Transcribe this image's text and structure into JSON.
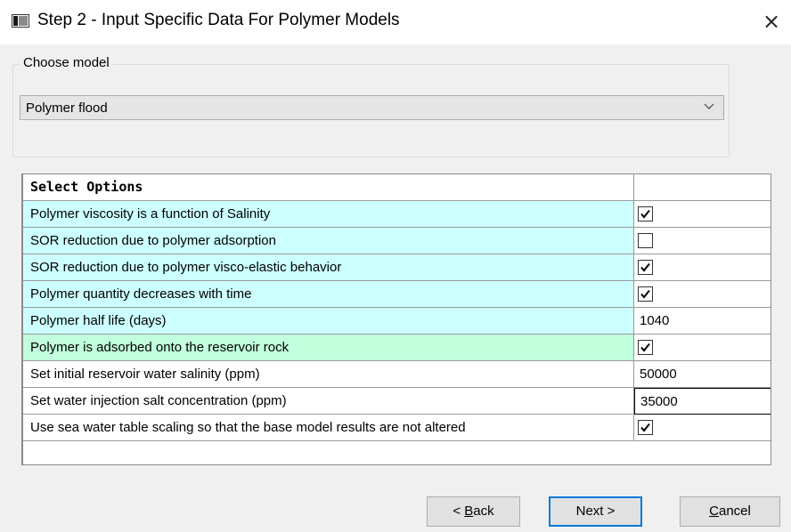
{
  "window": {
    "title": "Step 2 - Input Specific Data For Polymer Models",
    "close_glyph": "×"
  },
  "model_group": {
    "label": "Choose model",
    "selected": "Polymer flood"
  },
  "options_grid": {
    "header": "Select Options",
    "rows": [
      {
        "label": "Polymer viscosity is a function of Salinity",
        "type": "checkbox",
        "checked": true,
        "row_color": "#ccffff"
      },
      {
        "label": "SOR reduction due to polymer adsorption",
        "type": "checkbox",
        "checked": false,
        "row_color": "#ccffff"
      },
      {
        "label": "SOR reduction due to polymer visco-elastic behavior",
        "type": "checkbox",
        "checked": true,
        "row_color": "#ccffff"
      },
      {
        "label": "Polymer quantity decreases with time",
        "type": "checkbox",
        "checked": true,
        "row_color": "#ccffff"
      },
      {
        "label": "Polymer half life (days)",
        "type": "value",
        "value": "1040",
        "row_color": "#ccffff"
      },
      {
        "label": "Polymer is adsorbed onto the reservoir rock",
        "type": "checkbox",
        "checked": true,
        "row_color": "#c2ffdc"
      },
      {
        "label": "Set initial reservoir water salinity (ppm)",
        "type": "value",
        "value": "50000",
        "row_color": "#ffffff"
      },
      {
        "label": "Set water injection salt concentration (ppm)",
        "type": "value",
        "value": "35000",
        "row_color": "#ffffff",
        "editing": true
      },
      {
        "label": "Use sea water table scaling so that the base model results are not altered",
        "type": "checkbox",
        "checked": true,
        "row_color": "#ffffff"
      }
    ]
  },
  "buttons": {
    "back": {
      "prefix": "< ",
      "mnemonic": "B",
      "rest": "ack"
    },
    "next": "Next >",
    "cancel": {
      "mnemonic": "C",
      "rest": "ancel"
    }
  },
  "colors": {
    "accent": "#0078d7",
    "highlight_row": "#ccffff",
    "selected_row": "#c2ffdc"
  }
}
